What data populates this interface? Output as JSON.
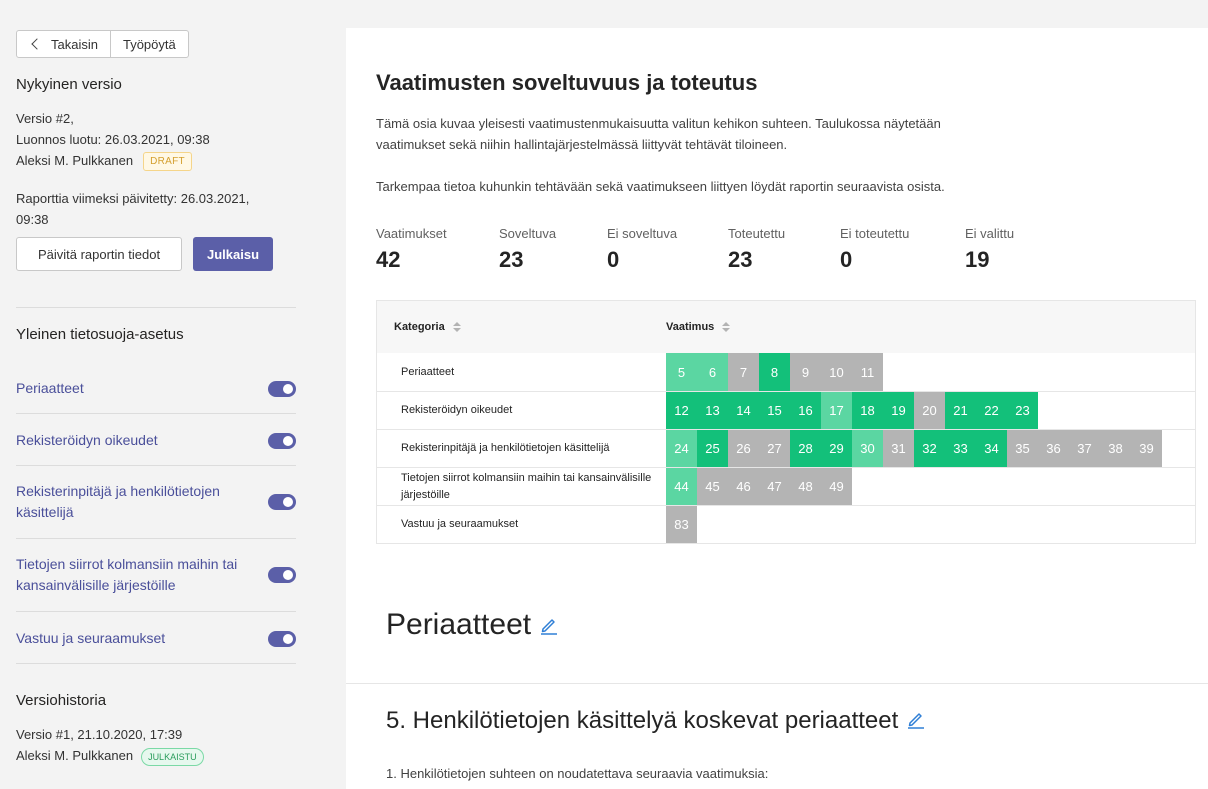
{
  "sidebar": {
    "back_label": "Takaisin",
    "desktop_label": "Työpöytä",
    "current_version_heading": "Nykyinen versio",
    "version_line": "Versio #2,",
    "draft_created": "Luonnos luotu: 26.03.2021, 09:38",
    "author": "Aleksi M. Pulkkanen",
    "draft_badge": "DRAFT",
    "updated_line1": "Raporttia viimeksi päivitetty: 26.03.2021,",
    "updated_line2": "09:38",
    "refresh_button": "Päivitä raportin tiedot",
    "publish_button": "Julkaisu",
    "framework_heading": "Yleinen tietosuoja-asetus",
    "nav_items": [
      {
        "label": "Periaatteet",
        "enabled": true
      },
      {
        "label": "Rekisteröidyn oikeudet",
        "enabled": true
      },
      {
        "label": "Rekisterinpitäjä ja henkilötietojen käsittelijä",
        "enabled": true
      },
      {
        "label": "Tietojen siirrot kolmansiin maihin tai kansainvälisille järjestöille",
        "enabled": true
      },
      {
        "label": "Vastuu ja seuraamukset",
        "enabled": true
      }
    ],
    "history_heading": "Versiohistoria",
    "history_version": "Versio #1, 21.10.2020, 17:39",
    "history_author": "Aleksi M. Pulkkanen",
    "history_badge": "JULKAISTU"
  },
  "main": {
    "title": "Vaatimusten soveltuvuus ja toteutus",
    "description": "Tämä osia kuvaa yleisesti vaatimustenmukaisuutta valitun kehikon suhteen. Taulukossa näytetään vaatimukset sekä niihin hallintajärjestelmässä liittyvät tehtävät tiloineen.",
    "description2": "Tarkempaa tietoa kuhunkin tehtävään sekä vaatimukseen liittyen löydät raportin seuraavista osista.",
    "stats": [
      {
        "label": "Vaatimukset",
        "value": "42"
      },
      {
        "label": "Soveltuva",
        "value": "23"
      },
      {
        "label": "Ei soveltuva",
        "value": "0"
      },
      {
        "label": "Toteutettu",
        "value": "23"
      },
      {
        "label": "Ei toteutettu",
        "value": "0"
      },
      {
        "label": "Ei valittu",
        "value": "19"
      }
    ],
    "table": {
      "col_category": "Kategoria",
      "col_requirement": "Vaatimus",
      "rows": [
        {
          "category": "Periaatteet",
          "cells": [
            [
              "5",
              "light"
            ],
            [
              "6",
              "light"
            ],
            [
              "7",
              "grey"
            ],
            [
              "8",
              "dark"
            ],
            [
              "9",
              "grey"
            ],
            [
              "10",
              "grey"
            ],
            [
              "11",
              "grey"
            ]
          ]
        },
        {
          "category": "Rekisteröidyn oikeudet",
          "cells": [
            [
              "12",
              "dark"
            ],
            [
              "13",
              "dark"
            ],
            [
              "14",
              "dark"
            ],
            [
              "15",
              "dark"
            ],
            [
              "16",
              "dark"
            ],
            [
              "17",
              "light"
            ],
            [
              "18",
              "dark"
            ],
            [
              "19",
              "dark"
            ],
            [
              "20",
              "grey"
            ],
            [
              "21",
              "dark"
            ],
            [
              "22",
              "dark"
            ],
            [
              "23",
              "dark"
            ]
          ]
        },
        {
          "category": "Rekisterinpitäjä ja henkilötietojen käsittelijä",
          "cells": [
            [
              "24",
              "light"
            ],
            [
              "25",
              "dark"
            ],
            [
              "26",
              "grey"
            ],
            [
              "27",
              "grey"
            ],
            [
              "28",
              "dark"
            ],
            [
              "29",
              "dark"
            ],
            [
              "30",
              "light"
            ],
            [
              "31",
              "grey"
            ],
            [
              "32",
              "dark"
            ],
            [
              "33",
              "dark"
            ],
            [
              "34",
              "dark"
            ],
            [
              "35",
              "grey"
            ],
            [
              "36",
              "grey"
            ],
            [
              "37",
              "grey"
            ],
            [
              "38",
              "grey"
            ],
            [
              "39",
              "grey"
            ]
          ]
        },
        {
          "category": "Tietojen siirrot kolmansiin maihin tai kansainvälisille järjestöille",
          "cells": [
            [
              "44",
              "light"
            ],
            [
              "45",
              "grey"
            ],
            [
              "46",
              "grey"
            ],
            [
              "47",
              "grey"
            ],
            [
              "48",
              "grey"
            ],
            [
              "49",
              "grey"
            ]
          ]
        },
        {
          "category": "Vastuu ja seuraamukset",
          "cells": [
            [
              "83",
              "grey"
            ]
          ]
        }
      ]
    },
    "section_heading": "Periaatteet",
    "sub_heading": "5. Henkilötietojen käsittelyä koskevat periaatteet",
    "sub_text": "1. Henkilötietojen suhteen on noudatettava seuraavia vaatimuksia:"
  },
  "colors": {
    "accent": "#5b5fa8",
    "implemented": "#13c07a",
    "applicable": "#5bd6a2",
    "not_selected": "#b4b4b4",
    "draft": "#d49f2e",
    "published": "#2a9d5c"
  }
}
